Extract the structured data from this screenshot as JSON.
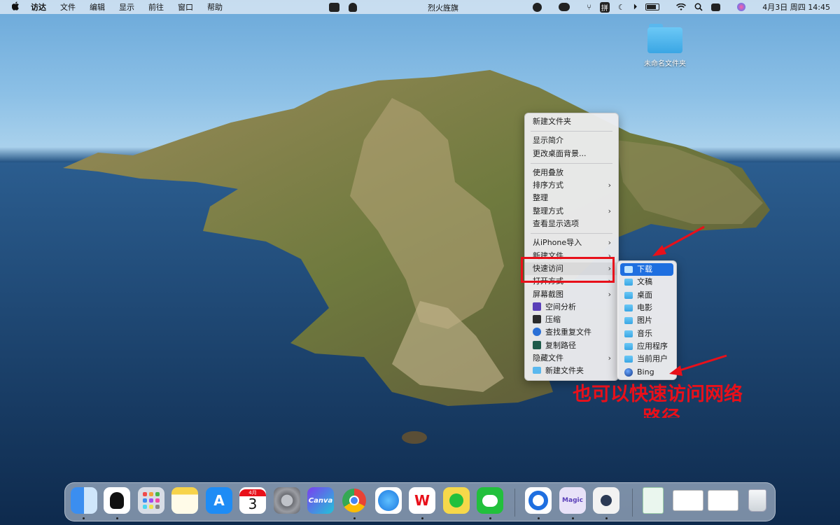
{
  "menubar": {
    "apple": "",
    "app_name": "访达",
    "items": [
      "文件",
      "编辑",
      "显示",
      "前往",
      "窗口",
      "帮助"
    ],
    "window_title": "烈火旌旗",
    "date_time": "4月3日 周四  14:45",
    "input_method": "拼"
  },
  "desktop": {
    "folder_label": "未命名文件夹"
  },
  "context_menu": {
    "items": [
      {
        "label": "新建文件夹"
      },
      {
        "label": "显示简介"
      },
      {
        "label": "更改桌面背景..."
      },
      {
        "label": "使用叠放"
      },
      {
        "label": "排序方式",
        "arrow": "›"
      },
      {
        "label": "整理"
      },
      {
        "label": "整理方式",
        "arrow": "›"
      },
      {
        "label": "查看显示选项"
      },
      {
        "label": "从iPhone导入",
        "arrow": "›"
      },
      {
        "label": "新建文件",
        "arrow": "›"
      },
      {
        "label": "快速访问",
        "arrow": "›"
      },
      {
        "label": "打开方式",
        "arrow": "›"
      },
      {
        "label": "屏幕截图",
        "arrow": "›"
      },
      {
        "label": "空间分析",
        "icon": "space-analysis-icon",
        "icon_color": "#5a3fb8"
      },
      {
        "label": "压缩",
        "icon": "compress-icon",
        "icon_color": "#2b2b2b"
      },
      {
        "label": "查找重复文件",
        "icon": "duplicate-finder-icon",
        "icon_color": "#2a6fd6"
      },
      {
        "label": "复制路径",
        "icon": "copy-path-icon",
        "icon_color": "#1e5a4a"
      },
      {
        "label": "隐藏文件",
        "arrow": "›"
      },
      {
        "label": "新建文件夹",
        "icon": "folder-icon",
        "icon_color": "#5ab8ee"
      }
    ]
  },
  "submenu": {
    "items": [
      "下载",
      "文稿",
      "桌面",
      "电影",
      "图片",
      "音乐",
      "应用程序",
      "当前用户",
      "Bing"
    ]
  },
  "annotation": {
    "text_line1": "也可以快速访问网络",
    "text_line2": "路径",
    "color": "#e8101a"
  },
  "dock": {
    "apps": [
      {
        "name": "finder",
        "label": "",
        "color": "#3b8ef0"
      },
      {
        "name": "qq",
        "label": "",
        "color": "#ffffff"
      },
      {
        "name": "launchpad",
        "label": "",
        "color": "#d8dde6"
      },
      {
        "name": "notes",
        "label": "",
        "color": "#f7d34a"
      },
      {
        "name": "app-store",
        "label": "A",
        "color": "#1e8cf5"
      },
      {
        "name": "calendar",
        "label": "3",
        "month": "4月",
        "color": "#ffffff"
      },
      {
        "name": "system-settings",
        "label": "",
        "color": "#8c8c92"
      },
      {
        "name": "canva",
        "label": "Canva",
        "color": "#6b3fd6"
      },
      {
        "name": "chrome",
        "label": "",
        "color": "#ffffff"
      },
      {
        "name": "safari",
        "label": "",
        "color": "#2f9cf0"
      },
      {
        "name": "wps",
        "label": "W",
        "color": "#ffffff"
      },
      {
        "name": "qq-music",
        "label": "",
        "color": "#f6d84a"
      },
      {
        "name": "wechat",
        "label": "",
        "color": "#22c03c"
      },
      {
        "name": "quark",
        "label": "",
        "color": "#ffffff"
      },
      {
        "name": "magic",
        "label": "Magic",
        "color": "#e8e2f8"
      },
      {
        "name": "avatar-app",
        "label": "",
        "color": "#f2f2f2"
      },
      {
        "name": "doc-window-1",
        "label": "",
        "color": "#eaf6ee"
      },
      {
        "name": "doc-window-2",
        "label": "",
        "color": "#ffffff"
      },
      {
        "name": "doc-window-3",
        "label": "",
        "color": "#ffffff"
      },
      {
        "name": "trash",
        "label": "",
        "color": "#e8ecef"
      }
    ]
  }
}
